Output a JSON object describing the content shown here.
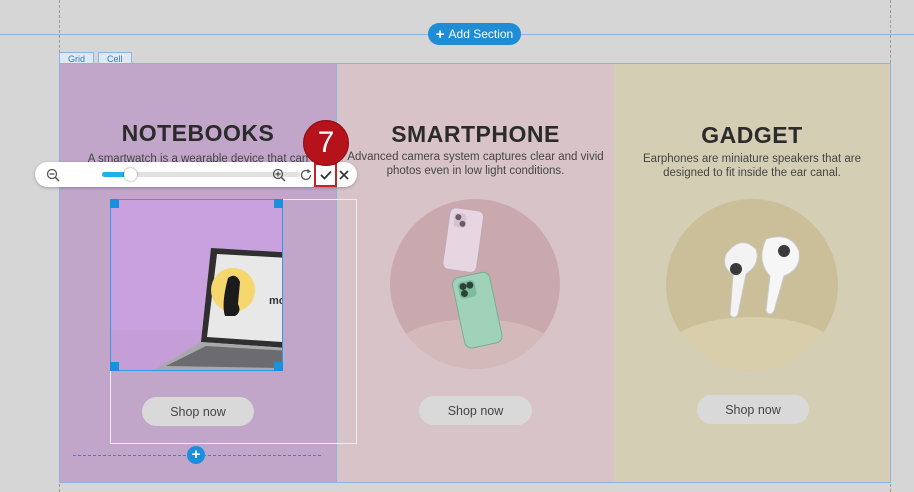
{
  "editor": {
    "add_section_label": "Add Section",
    "grid_tag": "Grid",
    "cell_tag": "Cell",
    "step_number": "7",
    "zoom_level": 0.14
  },
  "colors": {
    "accent": "#1f8dd6",
    "step_badge": "#b5121b",
    "highlight": "#c62424",
    "slider": "#1fb2e8"
  },
  "cards": [
    {
      "title": "NOTEBOOKS",
      "description": "A smartwatch is a wearable device that can",
      "button": "Shop now",
      "image_text": "mockup design"
    },
    {
      "title": "SMARTPHONE",
      "description": "Advanced camera system captures clear and vivid photos even in low light conditions.",
      "button": "Shop now"
    },
    {
      "title": "GADGET",
      "description": "Earphones are miniature speakers that are designed to fit inside the ear canal.",
      "button": "Shop now"
    }
  ],
  "icons": {
    "zoom_out": "zoom-out-icon",
    "zoom_in": "zoom-in-icon",
    "rotate": "rotate-icon",
    "confirm": "check-icon",
    "cancel": "close-icon"
  }
}
